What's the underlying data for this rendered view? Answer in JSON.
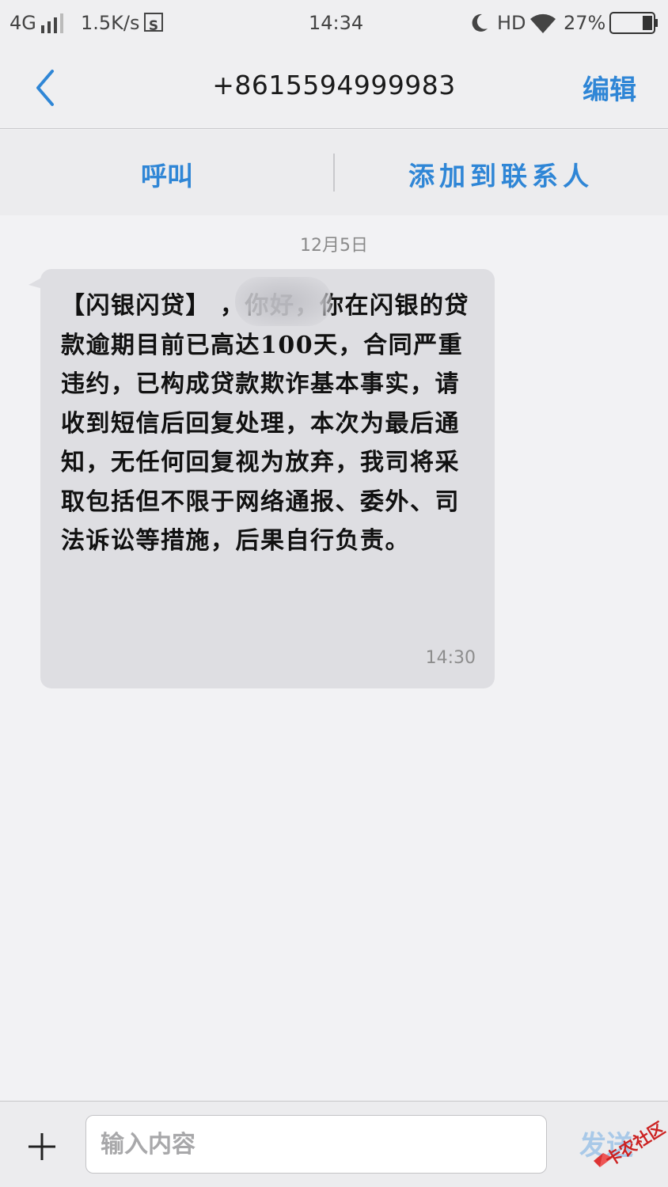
{
  "status_bar": {
    "network": "4G",
    "speed": "1.5K/s",
    "sim_icon_label": "S",
    "time": "14:34",
    "hd": "HD",
    "battery": "27%"
  },
  "nav": {
    "back_icon": "chevron-left-icon",
    "title": "+8615594999983",
    "edit_label": "编辑"
  },
  "actions": {
    "call_label": "呼叫",
    "add_contact_label": "添加到联系人"
  },
  "thread": {
    "date": "12月5日",
    "messages": [
      {
        "text": "【闪银闪贷】       ，你好，你在闪银的贷款逾期目前已高达100天，合同严重违约，已构成贷款欺诈基本事实，请收到短信后回复处理，本次为最后通知，无任何回复视为放弃，我司将采取包括但不限于网络通报、委外、司法诉讼等措施，后果自行负责。",
        "time": "14:30"
      }
    ]
  },
  "composer": {
    "plus_icon": "plus-icon",
    "placeholder": "输入内容",
    "send_label": "发送"
  },
  "watermark": {
    "text": "卡农社区"
  },
  "colors": {
    "accent": "#2f86d6",
    "bubble": "#dedee2",
    "background": "#f2f2f4"
  }
}
